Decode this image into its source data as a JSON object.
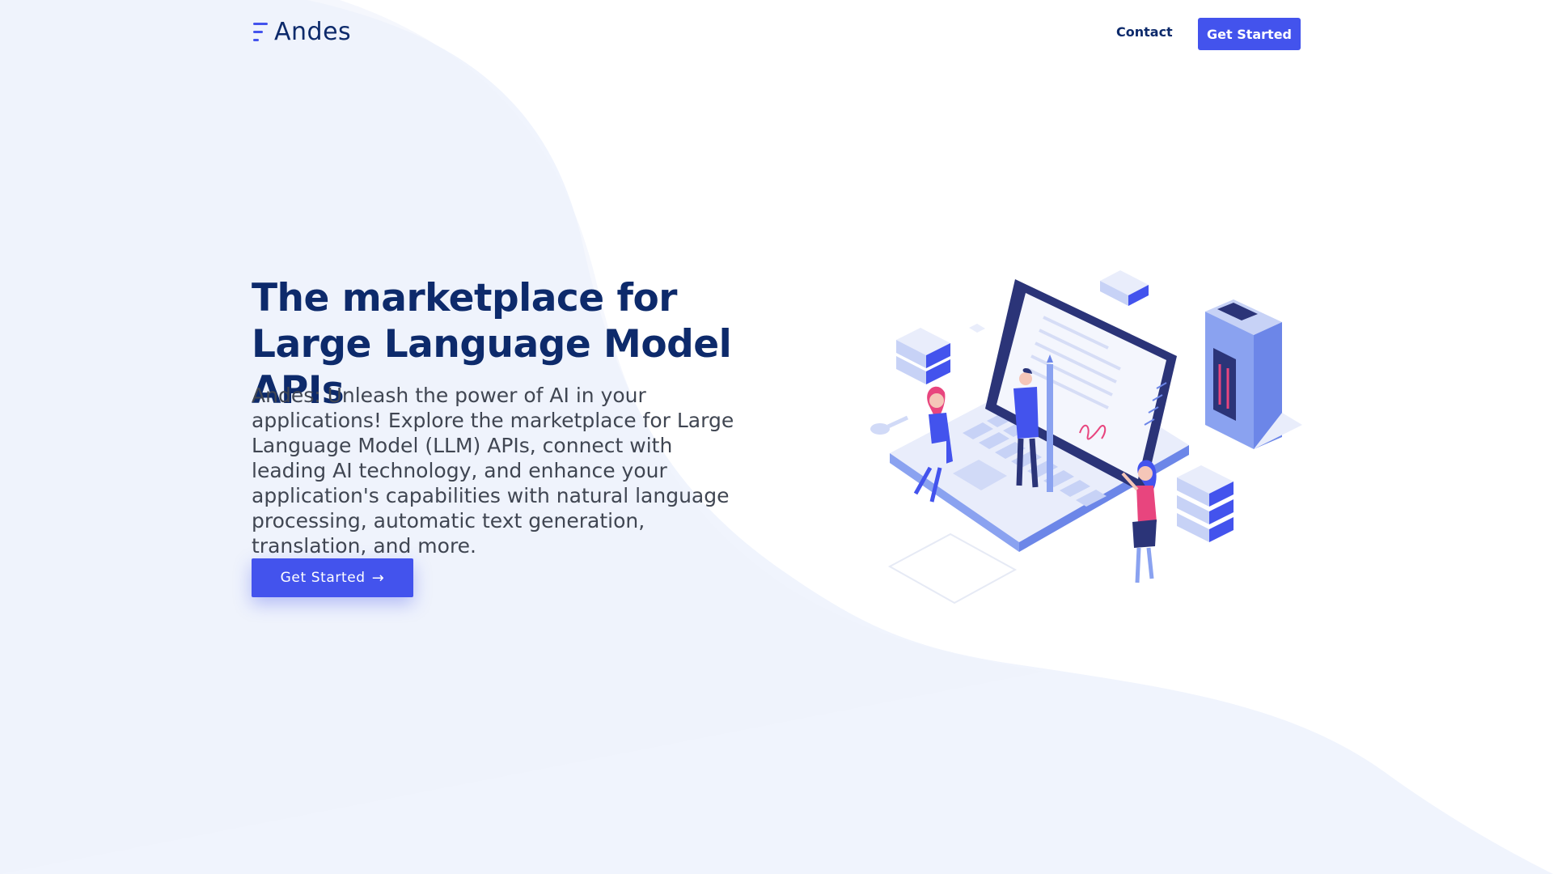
{
  "brand": {
    "name": "Andes",
    "accent_color": "#4353ed",
    "title_color": "#0d2a6b"
  },
  "nav": {
    "contact_label": "Contact",
    "cta_label": "Get Started"
  },
  "hero": {
    "title": "The marketplace for Large Language Model APIs",
    "description": "Andes: Unleash the power of AI in your applications! Explore the marketplace for Large Language Model (LLM) APIs, connect with leading AI technology, and enhance your application's capabilities with natural language processing, automatic text generation, translation, and more.",
    "cta_label": "Get Started",
    "cta_icon": "arrow-right-icon",
    "illustration": "isometric-laptop-people-servers-illustration"
  }
}
